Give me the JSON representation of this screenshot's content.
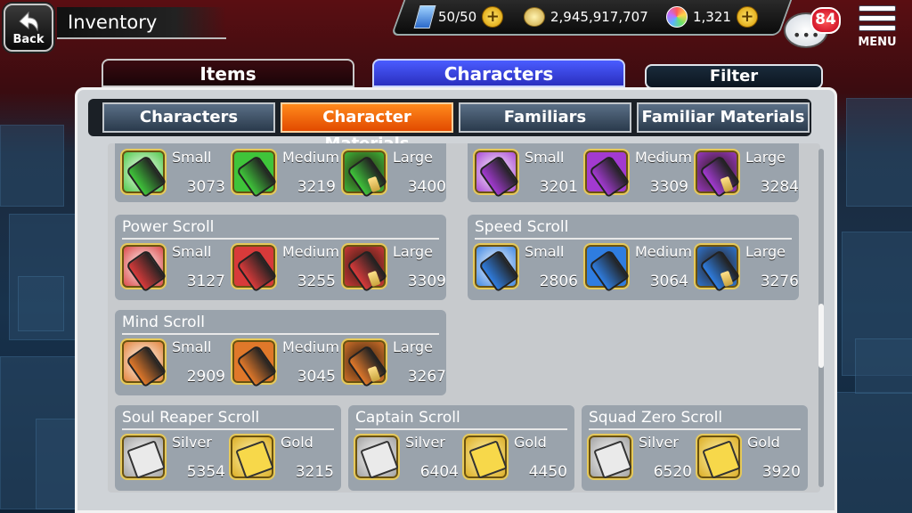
{
  "header": {
    "back_label": "Back",
    "title": "Inventory",
    "stamina": "50/50",
    "coins": "2,945,917,707",
    "orbs": "1,321",
    "notification_count": "84",
    "menu_label": "MENU"
  },
  "tabs": {
    "items": "Items",
    "characters": "Characters",
    "filter": "Filter"
  },
  "subtabs": [
    "Characters",
    "Character Materials",
    "Familiars",
    "Familiar Materials"
  ],
  "active_subtab": "Character Materials",
  "groups": [
    {
      "id": "green",
      "title": "",
      "color": "#3fc43a",
      "items": [
        {
          "size": "Small",
          "qty": "3073"
        },
        {
          "size": "Medium",
          "qty": "3219"
        },
        {
          "size": "Large",
          "qty": "3400"
        }
      ]
    },
    {
      "id": "purple",
      "title": "",
      "color": "#a23ad0",
      "items": [
        {
          "size": "Small",
          "qty": "3201"
        },
        {
          "size": "Medium",
          "qty": "3309"
        },
        {
          "size": "Large",
          "qty": "3284"
        }
      ]
    },
    {
      "id": "power",
      "title": "Power Scroll",
      "color": "#d83a3a",
      "items": [
        {
          "size": "Small",
          "qty": "3127"
        },
        {
          "size": "Medium",
          "qty": "3255"
        },
        {
          "size": "Large",
          "qty": "3309"
        }
      ]
    },
    {
      "id": "speed",
      "title": "Speed Scroll",
      "color": "#2f7de0",
      "items": [
        {
          "size": "Small",
          "qty": "2806"
        },
        {
          "size": "Medium",
          "qty": "3064"
        },
        {
          "size": "Large",
          "qty": "3276"
        }
      ]
    },
    {
      "id": "mind",
      "title": "Mind Scroll",
      "color": "#e0782a",
      "items": [
        {
          "size": "Small",
          "qty": "2909"
        },
        {
          "size": "Medium",
          "qty": "3045"
        },
        {
          "size": "Large",
          "qty": "3267"
        }
      ]
    },
    {
      "id": "soul",
      "title": "Soul Reaper Scroll",
      "color": "#b9b9b9",
      "items": [
        {
          "size": "Silver",
          "qty": "5354"
        },
        {
          "size": "Gold",
          "qty": "3215"
        }
      ]
    },
    {
      "id": "captain",
      "title": "Captain Scroll",
      "color": "#b9b9b9",
      "items": [
        {
          "size": "Silver",
          "qty": "6404"
        },
        {
          "size": "Gold",
          "qty": "4450"
        }
      ]
    },
    {
      "id": "squad",
      "title": "Squad Zero Scroll",
      "color": "#b9b9b9",
      "items": [
        {
          "size": "Silver",
          "qty": "6520"
        },
        {
          "size": "Gold",
          "qty": "3920"
        }
      ]
    }
  ]
}
